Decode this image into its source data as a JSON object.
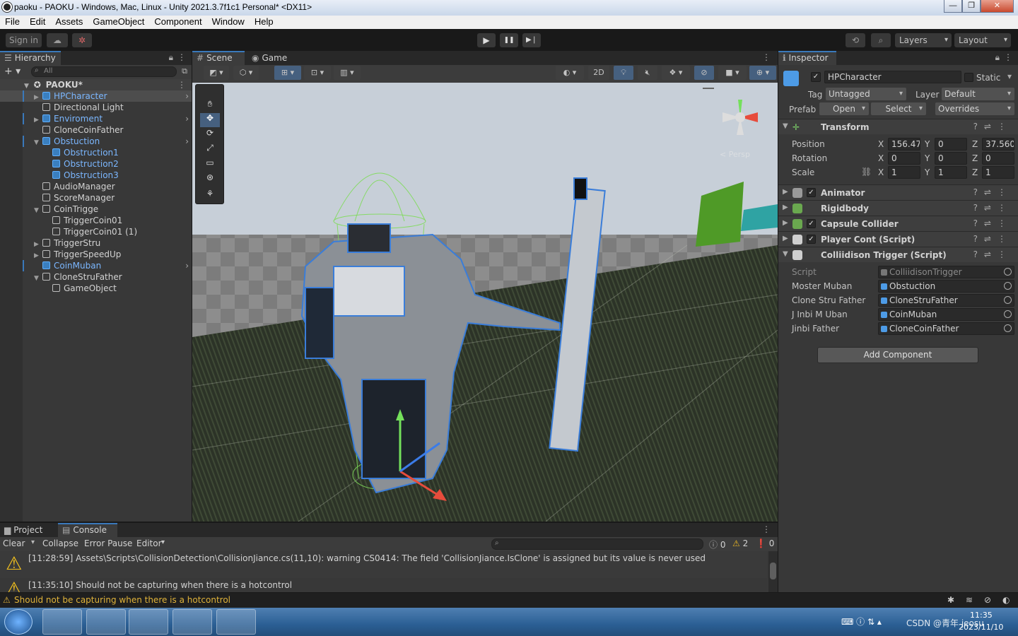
{
  "window": {
    "title": "paoku - PAOKU - Windows, Mac, Linux - Unity 2021.3.7f1c1 Personal* <DX11>",
    "controls": [
      "—",
      "❐",
      "✕"
    ]
  },
  "menu": [
    "File",
    "Edit",
    "Assets",
    "GameObject",
    "Component",
    "Window",
    "Help"
  ],
  "toolbar": {
    "sign_in": "Sign in",
    "play": "▶",
    "pause": "❚❚",
    "step": "▶❘",
    "layers": "Layers",
    "layout": "Layout"
  },
  "hierarchy": {
    "tab": "Hierarchy",
    "search_placeholder": "All",
    "scene_name": "PAOKU*",
    "items": [
      {
        "label": "HPCharacter",
        "blue": true,
        "arrow": "▶",
        "chev": true,
        "depth": 1,
        "selected": true
      },
      {
        "label": "Directional Light",
        "blue": false,
        "arrow": "",
        "chev": false,
        "depth": 1
      },
      {
        "label": "Enviroment",
        "blue": true,
        "arrow": "▶",
        "chev": true,
        "depth": 1
      },
      {
        "label": "CloneCoinFather",
        "blue": false,
        "arrow": "",
        "chev": false,
        "depth": 1
      },
      {
        "label": "Obstuction",
        "blue": true,
        "arrow": "▼",
        "chev": true,
        "depth": 1
      },
      {
        "label": "Obstruction1",
        "blue": true,
        "arrow": "",
        "chev": false,
        "depth": 2
      },
      {
        "label": "Obstruction2",
        "blue": true,
        "arrow": "",
        "chev": false,
        "depth": 2
      },
      {
        "label": "Obstruction3",
        "blue": true,
        "arrow": "",
        "chev": false,
        "depth": 2
      },
      {
        "label": "AudioManager",
        "blue": false,
        "arrow": "",
        "chev": false,
        "depth": 1
      },
      {
        "label": "ScoreManager",
        "blue": false,
        "arrow": "",
        "chev": false,
        "depth": 1
      },
      {
        "label": "CoinTrigge",
        "blue": false,
        "arrow": "▼",
        "chev": false,
        "depth": 1
      },
      {
        "label": "TriggerCoin01",
        "blue": false,
        "arrow": "",
        "chev": false,
        "depth": 2
      },
      {
        "label": "TriggerCoin01 (1)",
        "blue": false,
        "arrow": "",
        "chev": false,
        "depth": 2
      },
      {
        "label": "TriggerStru",
        "blue": false,
        "arrow": "▶",
        "chev": false,
        "depth": 1
      },
      {
        "label": "TriggerSpeedUp",
        "blue": false,
        "arrow": "▶",
        "chev": false,
        "depth": 1
      },
      {
        "label": "CoinMuban",
        "blue": true,
        "arrow": "",
        "chev": true,
        "depth": 1
      },
      {
        "label": "CloneStruFather",
        "blue": false,
        "arrow": "▼",
        "chev": false,
        "depth": 1
      },
      {
        "label": "GameObject",
        "blue": false,
        "arrow": "",
        "chev": false,
        "depth": 2
      }
    ]
  },
  "scene": {
    "tabs": [
      "Scene",
      "Game"
    ],
    "mode_2d": "2D",
    "gizmo_label": "< Persp"
  },
  "inspector": {
    "tab": "Inspector",
    "object_name": "HPCharacter",
    "static_label": "Static",
    "tag_label": "Tag",
    "tag_value": "Untagged",
    "layer_label": "Layer",
    "layer_value": "Default",
    "prefab_label": "Prefab",
    "prefab_open": "Open",
    "prefab_select": "Select",
    "prefab_overrides": "Overrides",
    "transform": {
      "title": "Transform",
      "position_label": "Position",
      "rotation_label": "Rotation",
      "scale_label": "Scale",
      "position": {
        "x": "156.47",
        "y": "0",
        "z": "37.560"
      },
      "rotation": {
        "x": "0",
        "y": "0",
        "z": "0"
      },
      "scale": {
        "x": "1",
        "y": "1",
        "z": "1"
      },
      "axis_x": "X",
      "axis_y": "Y",
      "axis_z": "Z"
    },
    "components": [
      {
        "name": "Animator",
        "checkbox": true,
        "color": "#9a9a9a"
      },
      {
        "name": "Rigidbody",
        "checkbox": false,
        "color": "#6aa84f"
      },
      {
        "name": "Capsule Collider",
        "checkbox": true,
        "color": "#6aa84f"
      },
      {
        "name": "Player Cont (Script)",
        "checkbox": true,
        "color": "#cfcfcf"
      },
      {
        "name": "Colliidison Trigger (Script)",
        "checkbox": false,
        "color": "#cfcfcf"
      }
    ],
    "script_fields": [
      {
        "label": "Script",
        "value": "ColliidisonTrigger",
        "dim": true
      },
      {
        "label": "Moster Muban",
        "value": "Obstuction",
        "dim": false
      },
      {
        "label": "Clone Stru Father",
        "value": "CloneStruFather",
        "dim": false
      },
      {
        "label": "J Inbi M Uban",
        "value": "CoinMuban",
        "dim": false
      },
      {
        "label": "Jinbi Father",
        "value": "CloneCoinFather",
        "dim": false
      }
    ],
    "add_component": "Add Component"
  },
  "console": {
    "tabs": [
      "Project",
      "Console"
    ],
    "clear": "Clear",
    "collapse": "Collapse",
    "error_pause": "Error Pause",
    "editor": "Editor",
    "counts": {
      "info": "0",
      "warn": "2",
      "error": "0"
    },
    "messages": [
      "[11:28:59] Assets\\Scripts\\CollisionDetection\\CollisionJiance.cs(11,10): warning CS0414: The field 'CollisionJiance.IsClone' is assigned but its value is never used",
      "[11:35:10] Should not be capturing when there is a hotcontrol"
    ]
  },
  "statusbar": {
    "message": "Should not be capturing when there is a hotcontrol"
  },
  "taskbar": {
    "time": "11:35",
    "date": "2023/11/10",
    "watermark": "CSDN @青年 jeosu"
  }
}
